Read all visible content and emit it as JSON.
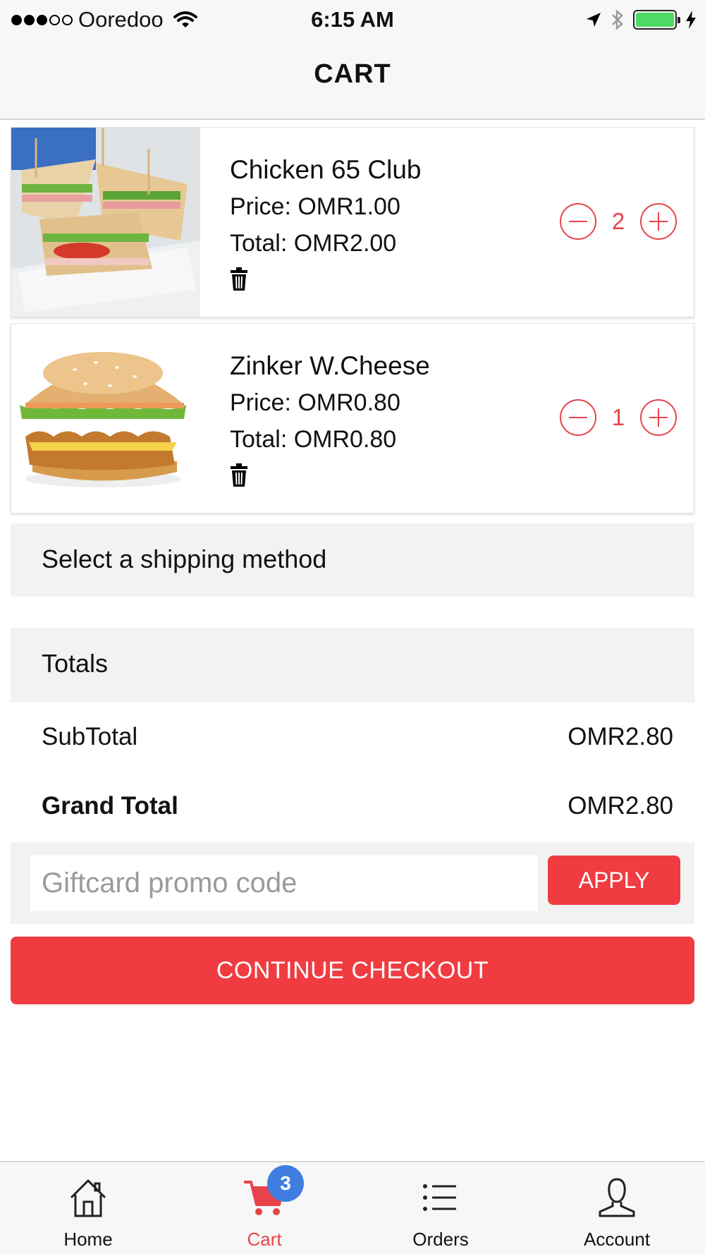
{
  "status_bar": {
    "carrier": "Ooredoo",
    "time": "6:15 AM",
    "signal_bars_filled": 3,
    "signal_bars_total": 5,
    "battery_level": 1.0
  },
  "header": {
    "title": "CART"
  },
  "cart_items": [
    {
      "name": "Chicken 65 Club",
      "price": "Price: OMR1.00",
      "total": "Total: OMR2.00",
      "quantity": "2",
      "image": "club-sandwich"
    },
    {
      "name": "Zinker W.Cheese",
      "price": "Price: OMR0.80",
      "total": "Total: OMR0.80",
      "quantity": "1",
      "image": "chicken-burger"
    }
  ],
  "shipping": {
    "label": "Select a shipping method"
  },
  "totals": {
    "heading": "Totals",
    "subtotal_label": "SubTotal",
    "subtotal_value": "OMR2.80",
    "grand_label": "Grand Total",
    "grand_value": "OMR2.80"
  },
  "promo": {
    "placeholder": "Giftcard promo code",
    "value": "",
    "apply_label": "APPLY"
  },
  "checkout": {
    "label": "CONTINUE CHECKOUT"
  },
  "tabs": [
    {
      "label": "Home",
      "icon": "home-icon"
    },
    {
      "label": "Cart",
      "icon": "cart-icon",
      "badge": "3",
      "active": true
    },
    {
      "label": "Orders",
      "icon": "list-icon"
    },
    {
      "label": "Account",
      "icon": "user-icon"
    }
  ],
  "colors": {
    "accent": "#f03c41",
    "badge": "#3f7de0",
    "battery": "#4cd964",
    "section_bg": "#f2f2f2"
  }
}
